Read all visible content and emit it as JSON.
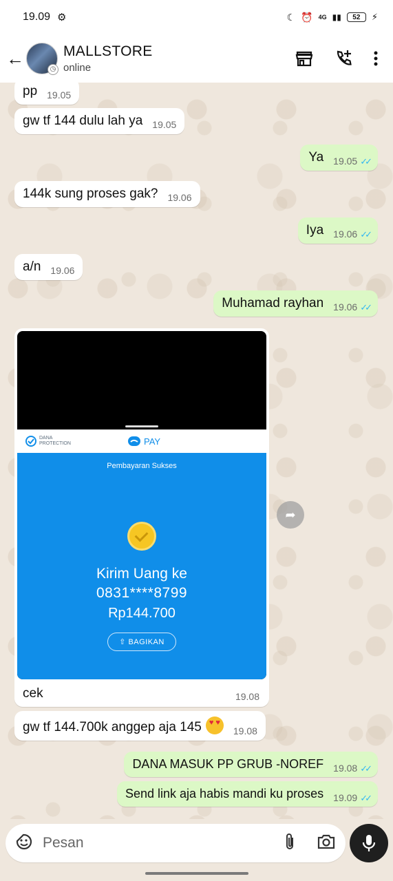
{
  "status_bar": {
    "time": "19.09",
    "network": "4G",
    "battery": "52"
  },
  "header": {
    "contact_name": "MALLSTORE",
    "status": "online"
  },
  "messages": [
    {
      "text": "pp",
      "time": "19.05",
      "dir": "in"
    },
    {
      "text": "gw tf 144 dulu lah ya",
      "time": "19.05",
      "dir": "in"
    },
    {
      "text": "Ya",
      "time": "19.05",
      "dir": "out",
      "read": true
    },
    {
      "text": "144k sung proses gak?",
      "time": "19.06",
      "dir": "in"
    },
    {
      "text": "Iya",
      "time": "19.06",
      "dir": "out",
      "read": true
    },
    {
      "text": "a/n",
      "time": "19.06",
      "dir": "in"
    },
    {
      "text": "Muhamad rayhan",
      "time": "19.06",
      "dir": "out",
      "read": true
    },
    {
      "text": "gw tf 144.700k anggep aja 145",
      "time": "19.08",
      "dir": "in",
      "emoji": "heart-eyes"
    },
    {
      "text": "DANA MASUK PP GRUB -NOREF",
      "time": "19.08",
      "dir": "out",
      "read": true
    },
    {
      "text": "Send link aja habis mandi ku proses",
      "time": "19.09",
      "dir": "out",
      "read": true
    }
  ],
  "image_message": {
    "caption": "cek",
    "time": "19.08",
    "receipt": {
      "protection_label": "DANA PROTECTION",
      "pay_label": "PAY",
      "status": "Pembayaran Sukses",
      "title": "Kirim Uang ke",
      "account": "0831****8799",
      "amount": "Rp144.700",
      "share_label": "BAGIKAN"
    }
  },
  "input": {
    "placeholder": "Pesan"
  },
  "colors": {
    "outgoing_bubble": "#dcf8c6",
    "incoming_bubble": "#ffffff",
    "read_ticks": "#34b7f1",
    "dana_blue": "#108ee9"
  }
}
